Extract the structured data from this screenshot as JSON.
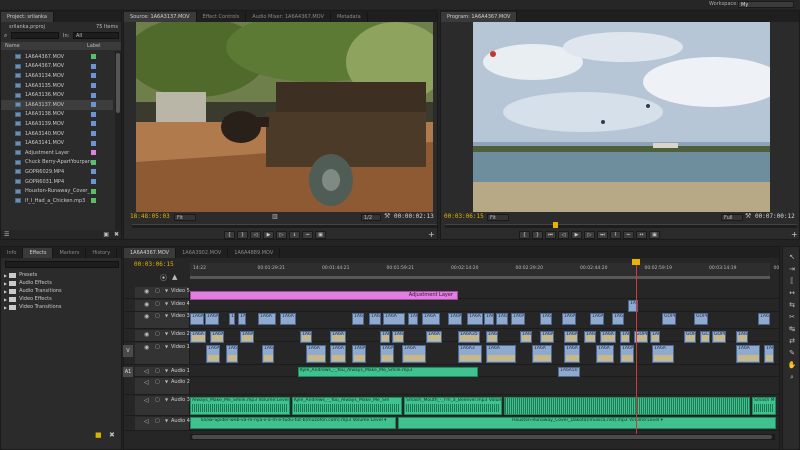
{
  "workspace": {
    "label": "Workspace:",
    "value": "My"
  },
  "project": {
    "tab": "Project: srilanka",
    "file": "srilanka.prproj",
    "count": "75 Items",
    "in_label": "In:",
    "in_value": "All",
    "col_name": "Name",
    "col_label": "Label",
    "items": [
      {
        "name": "1A6A4367.MOV",
        "color": "#59c06a"
      },
      {
        "name": "1A6A4367.MOV",
        "color": "#6b93d6"
      },
      {
        "name": "1A6A3134.MOV",
        "color": "#6b93d6"
      },
      {
        "name": "1A6A3135.MOV",
        "color": "#6b93d6"
      },
      {
        "name": "1A6A3136.MOV",
        "color": "#6b93d6"
      },
      {
        "name": "1A6A3137.MOV",
        "color": "#6b93d6"
      },
      {
        "name": "1A6A3138.MOV",
        "color": "#6b93d6"
      },
      {
        "name": "1A6A3139.MOV",
        "color": "#6b93d6"
      },
      {
        "name": "1A6A3140.MOV",
        "color": "#6b93d6"
      },
      {
        "name": "1A6A3141.MOV",
        "color": "#6b93d6"
      },
      {
        "name": "Adjustment Layer",
        "color": "#e07fe0"
      },
      {
        "name": "Chuck Berry-ApartYourpan",
        "color": "#59c06a"
      },
      {
        "name": "GOPR6029.MP4",
        "color": "#6b93d6"
      },
      {
        "name": "GOPR6031.MP4",
        "color": "#6b93d6"
      },
      {
        "name": "Houston-Runaway_Cover_",
        "color": "#59c06a"
      },
      {
        "name": "If_I_Had_a_Chicken.mp3",
        "color": "#59c06a"
      }
    ]
  },
  "effects": {
    "tabs": [
      "Info",
      "Effects",
      "Markers",
      "History"
    ],
    "items": [
      "Presets",
      "Audio Effects",
      "Audio Transitions",
      "Video Effects",
      "Video Transitions"
    ]
  },
  "source": {
    "tabs": [
      "Source: 1A6A3137.MOV",
      "Effect Controls",
      "Audio Mixer: 1A6A4367.MOV",
      "Metadata"
    ],
    "timecode": "18:48:05:03",
    "fit": "Fit",
    "ratio": "1/2",
    "duration": "00:00:02:13"
  },
  "program": {
    "tab": "Program: 1A6A4367.MOV",
    "timecode": "00:03:06:15",
    "fit": "Fit",
    "quality": "Full",
    "duration": "00:07:00:12"
  },
  "timeline": {
    "tabs": [
      "1A6A4367.MOV",
      "1A6A3902.MOV",
      "1A6A4889.MOV"
    ],
    "timecode": "00:03:06:15",
    "ruler": [
      "14:22",
      "00:01:29:21",
      "00:01:44:21",
      "00:01:59:21",
      "00:02:14:20",
      "00:02:29:20",
      "00:02:44:20",
      "00:02:59:19",
      "00:03:14:19",
      "00:03:29:18"
    ],
    "tracks": [
      {
        "name": "Video 5",
        "key": "v5"
      },
      {
        "name": "Video 4",
        "key": "v4"
      },
      {
        "name": "Video 3",
        "key": "v3"
      },
      {
        "name": "Video 2",
        "key": "v2"
      },
      {
        "name": "Video 1",
        "key": "v1"
      },
      {
        "name": "Audio 1",
        "key": "a1"
      },
      {
        "name": "Audio 2",
        "key": "a2"
      },
      {
        "name": "Audio 3",
        "key": "a3"
      },
      {
        "name": "Audio 4",
        "key": "a4"
      }
    ],
    "patch_v": "V",
    "patch_a": "A1",
    "adjustment_label": "Adjustment Layer",
    "clip_1a6a": "1A6A",
    "clip_gopr": "GOPR",
    "clip_gc": "GC",
    "clip_1a6a50": "1A6A50",
    "clip_1a6a3": "1A6A3",
    "clip_1a6a35": "1A6A35",
    "audio1_clip": "Kyle_Andrews_-_You_Always_Make_Me_Smile.mp3",
    "audio3_clips": [
      "Always_Make_Me_Smile.mp3  Volume:Level ▾",
      "Kyle_Andrews_-_You_Always_Make_Me_Sm",
      "Smash_Mouth_-_I'm_a_Believer.mp3  Volume:Level ▾",
      "Smash M"
    ],
    "audio4_clips": [
      "Snow-Spider-web-va-m-nya-v-a-m-e-tudu-tut-b(muzofon.com).mp3  Volume:Level ▾",
      "Houston-Runaway_Cover_Dakota(imusica.net).mp3  Volume:Level ▾"
    ]
  }
}
